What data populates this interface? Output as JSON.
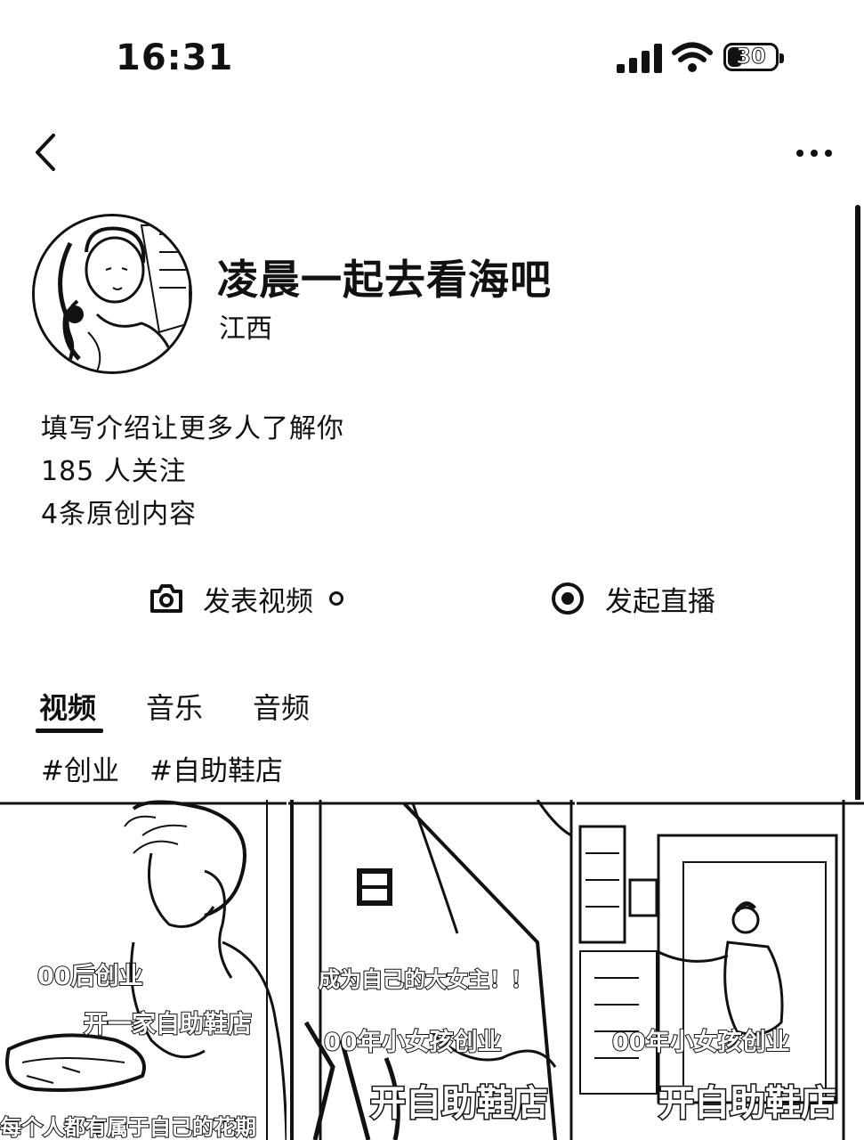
{
  "status_bar": {
    "time": "16:31",
    "battery": "30",
    "battery_level": 0.3
  },
  "nav": {
    "back_icon": "chevron-left-icon",
    "more_icon": "more-horizontal-icon"
  },
  "profile": {
    "nickname": "凌晨一起去看海吧",
    "location": "江西",
    "intro": "填写介绍让更多人了解你",
    "followers": "185 人关注",
    "original_count": "4条原创内容"
  },
  "actions": {
    "post_video": {
      "label": "发表视频",
      "icon": "camera-icon"
    },
    "go_live": {
      "label": "发起直播",
      "icon": "live-broadcast-icon"
    }
  },
  "tabs": [
    {
      "label": "视频",
      "active": true
    },
    {
      "label": "音乐",
      "active": false
    },
    {
      "label": "音频",
      "active": false
    }
  ],
  "tags": [
    "#创业",
    "#自助鞋店"
  ],
  "videos": [
    {
      "caption_1": "00后创业",
      "caption_2": "开一家自助鞋店",
      "caption_3": "每个人都有属于自己的花期"
    },
    {
      "caption_1": "成为自己的大女主！！",
      "caption_2": "00年小女孩创业",
      "caption_3": "开自助鞋店"
    },
    {
      "caption_1": "00年小女孩创业",
      "caption_2": "开自助鞋店"
    }
  ]
}
